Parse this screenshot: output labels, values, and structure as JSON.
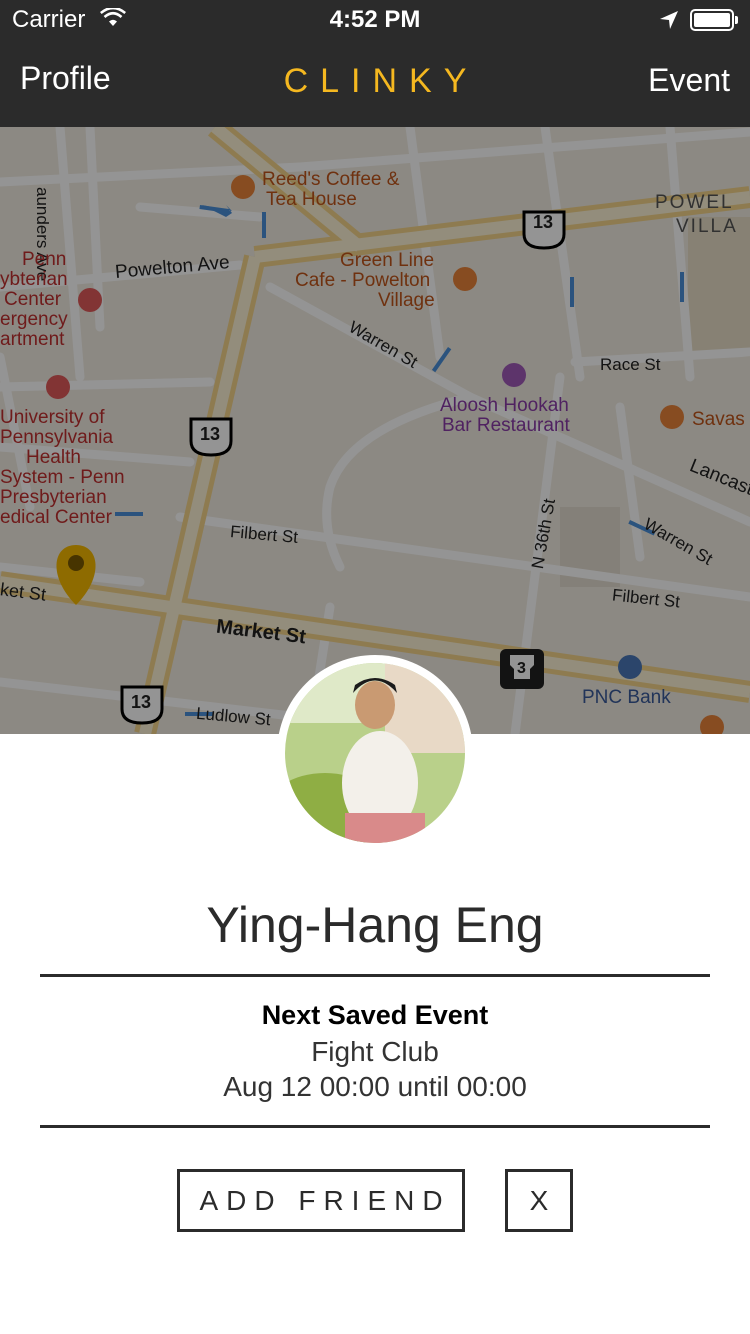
{
  "status_bar": {
    "carrier": "Carrier",
    "time": "4:52 PM"
  },
  "nav": {
    "left_label": "Profile",
    "title": "CLINKY",
    "right_label": "Event",
    "title_color": "#f5b820"
  },
  "map": {
    "labels": {
      "reeds_coffee_1": "Reed's Coffee &",
      "reeds_coffee_2": "Tea House",
      "powelton_ave": "Powelton Ave",
      "saunders_ave": "aunders Ave",
      "green_line_1": "Green Line",
      "green_line_2": "Cafe - Powelton",
      "green_line_3": "Village",
      "powelton_village_1": "POWEL",
      "powelton_village_2": "VILLA",
      "warren_st": "Warren St",
      "race_st": "Race St",
      "aloosh_1": "Aloosh Hookah",
      "aloosh_2": "Bar Restaurant",
      "savas": "Savas",
      "lancaster": "Lancast",
      "penn_1": "Penn",
      "penn_2": "ybterian",
      "penn_3": "Center",
      "penn_4": "ergency",
      "penn_5": "artment",
      "upenn_1": "University of",
      "upenn_2": "Pennsylvania",
      "upenn_3": "Health",
      "upenn_4": "System - Penn",
      "upenn_5": "Presbyterian",
      "upenn_6": "edical Center",
      "filbert_st_1": "Filbert St",
      "filbert_st_2": "Filbert St",
      "n36th": "N 36th St",
      "warren_st_2": "Warren St",
      "market_st": "Market St",
      "market_st_left": "ket St",
      "ludlow_st": "Ludlow St",
      "pnc_bank": "PNC Bank",
      "route_13_a": "13",
      "route_13_b": "13",
      "route_13_c": "13",
      "route_3": "3"
    }
  },
  "profile": {
    "name": "Ying-Hang Eng"
  },
  "next_event": {
    "heading": "Next Saved Event",
    "name": "Fight Club",
    "time": "Aug 12 00:00 until 00:00"
  },
  "actions": {
    "add_friend": "ADD FRIEND",
    "close": "X"
  }
}
